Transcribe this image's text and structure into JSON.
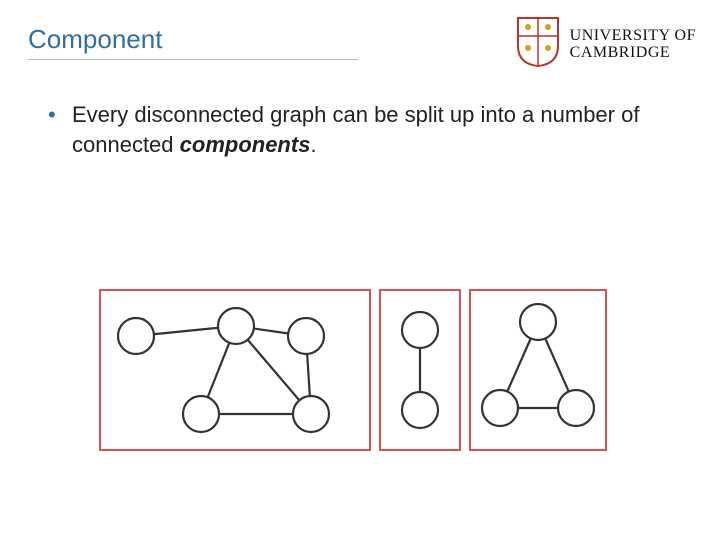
{
  "title": "Component",
  "logo": {
    "line1": "UNIVERSITY OF",
    "line2": "CAMBRIDGE"
  },
  "bullets": [
    {
      "prefix": "Every disconnected graph can be split up into a number of connected ",
      "emph": "components",
      "suffix": "."
    }
  ],
  "figure": {
    "description": "Three connected components of a disconnected graph, each outlined in red",
    "components": [
      {
        "nodes": 5,
        "edges": 6
      },
      {
        "nodes": 2,
        "edges": 1
      },
      {
        "nodes": 3,
        "edges": 3
      }
    ]
  }
}
